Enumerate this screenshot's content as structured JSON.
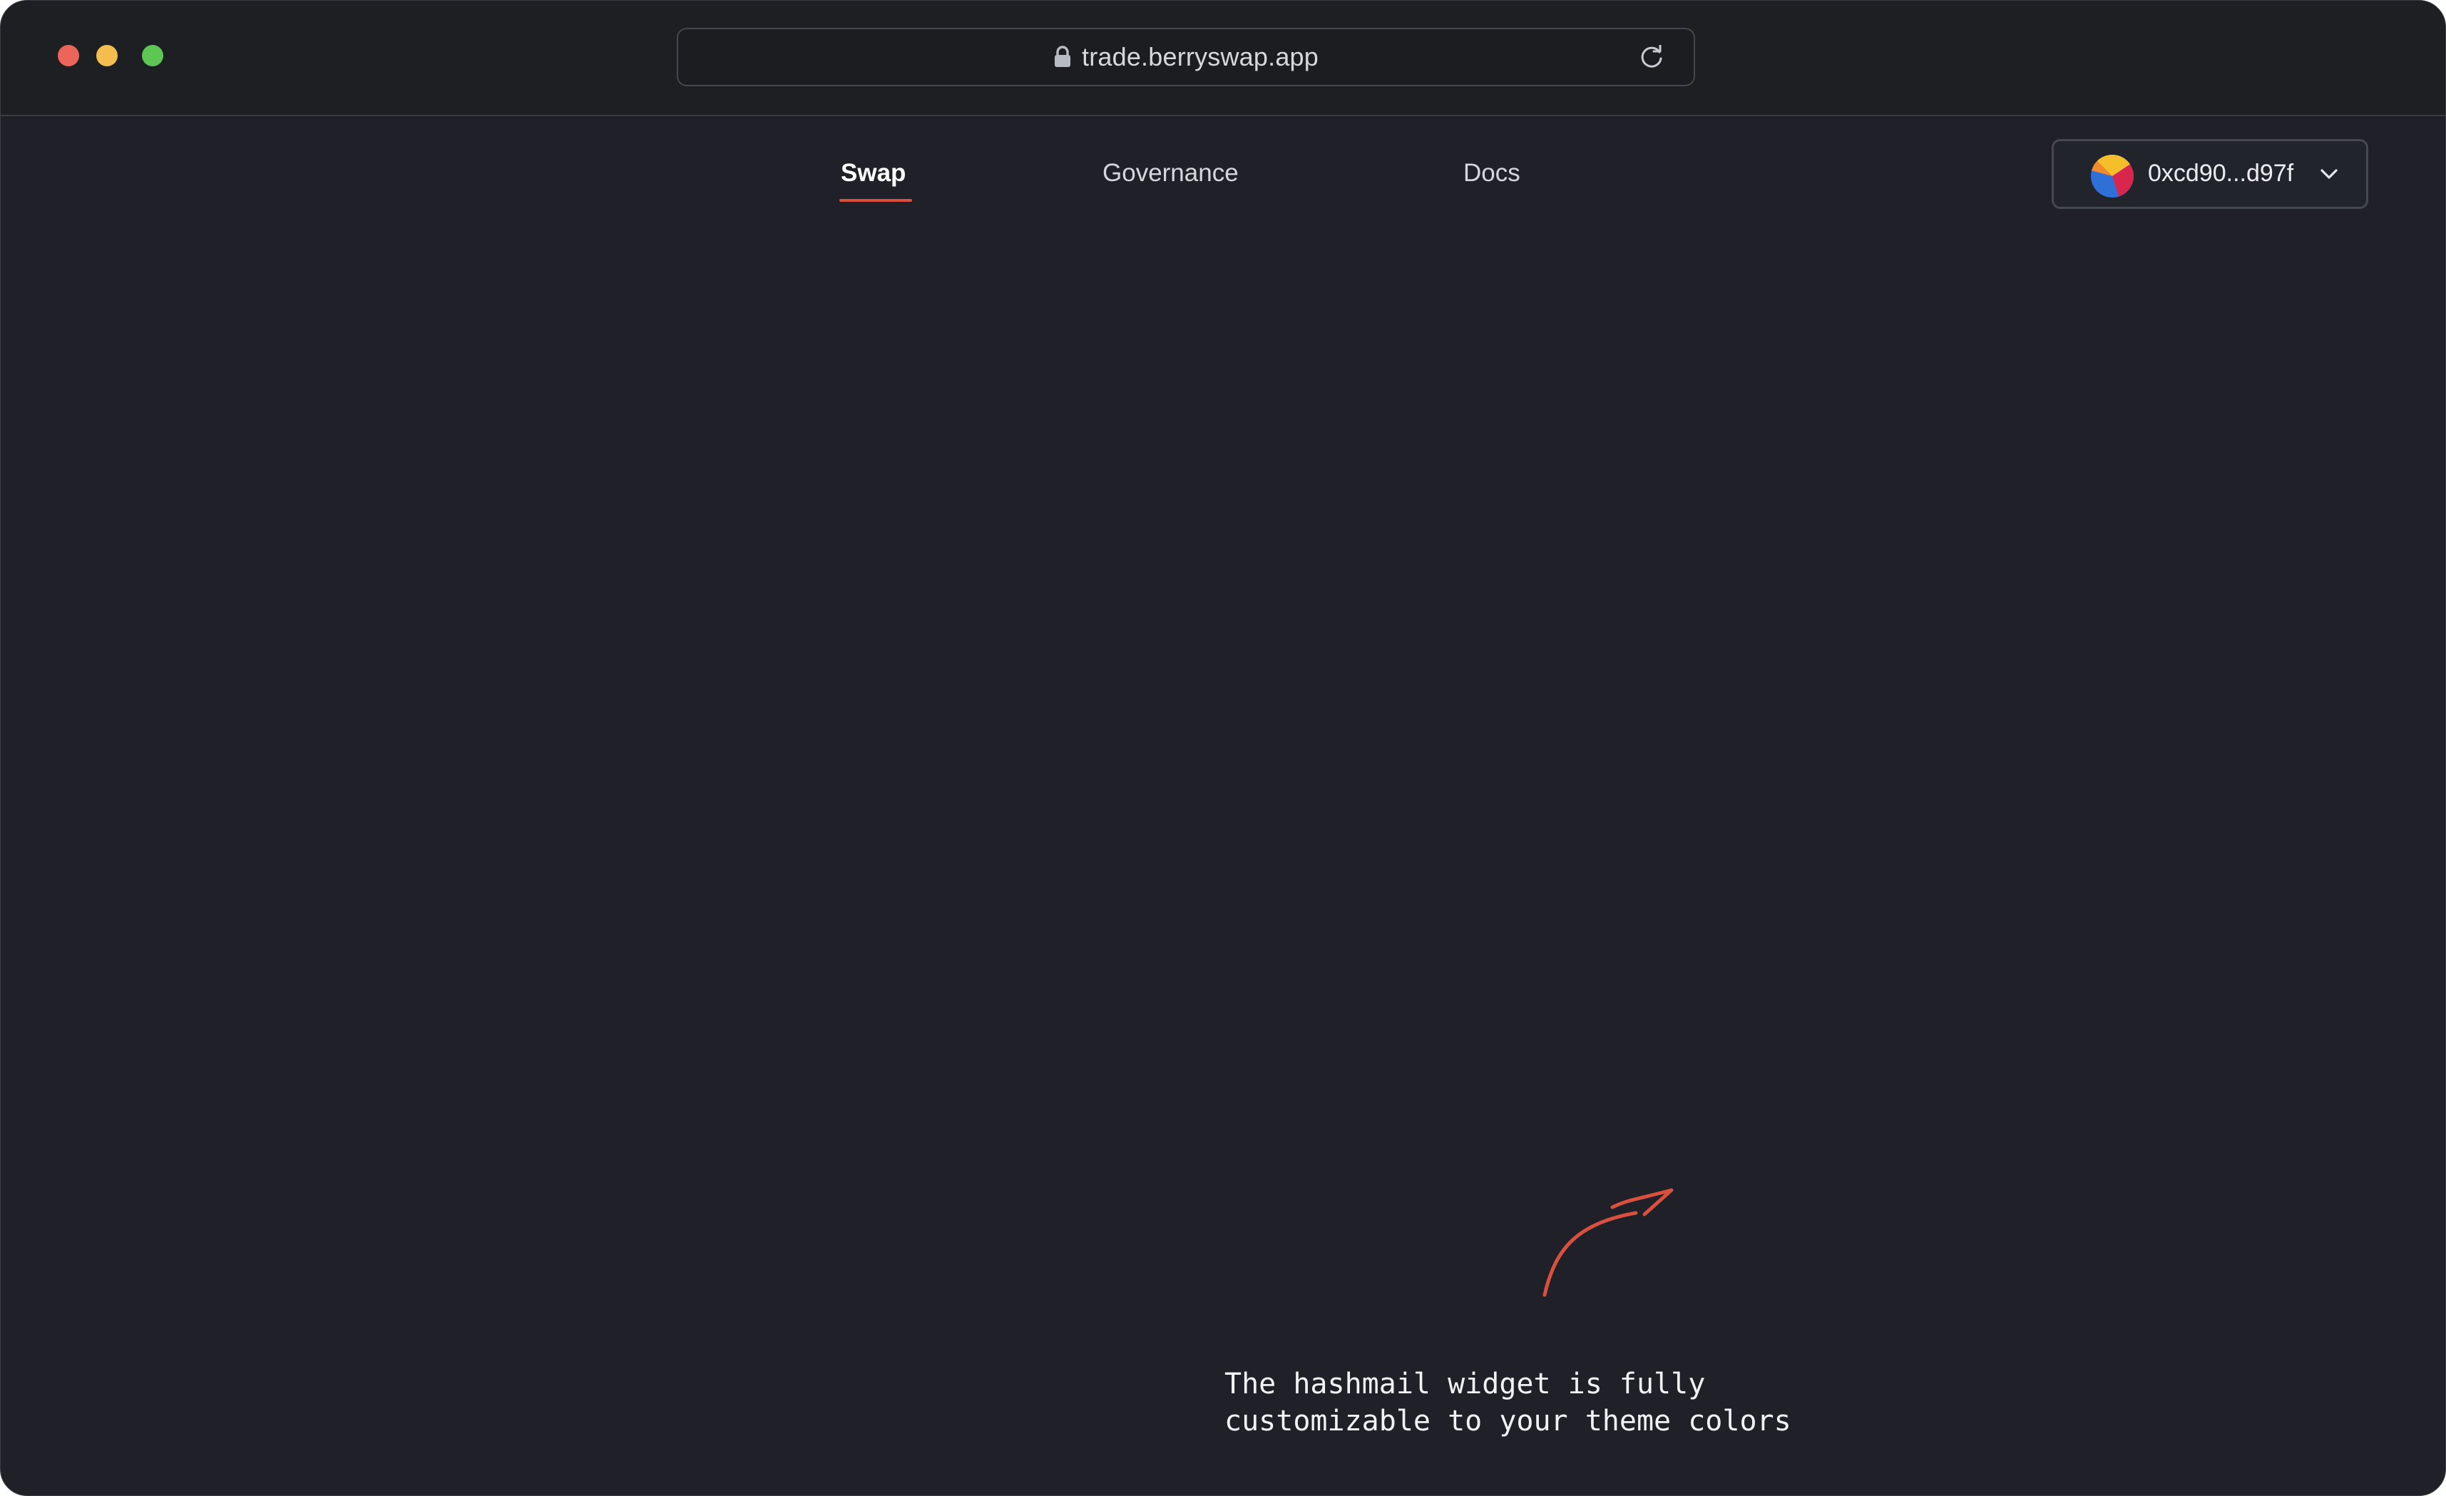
{
  "browser": {
    "url": "trade.berryswap.app",
    "traffic_lights": {
      "close_color": "#ec6559",
      "minimize_color": "#f4bd4f",
      "maximize_color": "#5ec754"
    },
    "icons": {
      "lock": "lock-icon",
      "reload": "reload-icon"
    }
  },
  "nav": {
    "items": [
      {
        "label": "Swap",
        "active": true
      },
      {
        "label": "Governance",
        "active": false
      },
      {
        "label": "Docs",
        "active": false
      }
    ],
    "accent_color": "#d9503f"
  },
  "wallet": {
    "address": "0xcd90...d97f",
    "avatar_icon": "wallet-avatar-icon",
    "dropdown_icon": "chevron-down-icon"
  },
  "annotation": {
    "line1": "The hashmail widget is fully",
    "line2": "customizable to your theme colors",
    "arrow_color": "#d9503f"
  },
  "colors": {
    "background": "#1f2028",
    "titlebar": "#1e1f23"
  }
}
